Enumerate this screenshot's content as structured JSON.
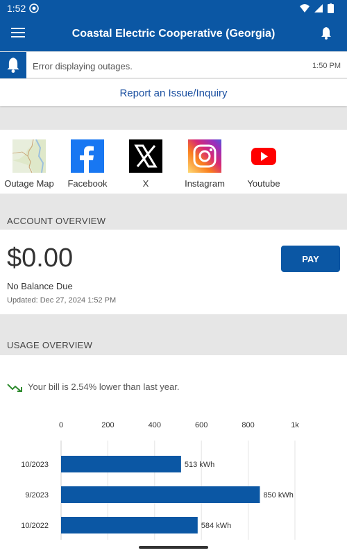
{
  "status_bar": {
    "time": "1:52"
  },
  "app_bar": {
    "title": "Coastal Electric Cooperative (Georgia)"
  },
  "alert": {
    "message": "Error displaying outages.",
    "time": "1:50 PM"
  },
  "report_link": "Report an Issue/Inquiry",
  "social": [
    {
      "label": "Outage Map",
      "icon": "map-icon"
    },
    {
      "label": "Facebook",
      "icon": "facebook-icon"
    },
    {
      "label": "X",
      "icon": "x-icon"
    },
    {
      "label": "Instagram",
      "icon": "instagram-icon"
    },
    {
      "label": "Youtube",
      "icon": "youtube-icon"
    }
  ],
  "account": {
    "section_title": "ACCOUNT OVERVIEW",
    "amount": "$0.00",
    "status": "No Balance Due",
    "updated": "Updated:  Dec 27, 2024 1:52 PM",
    "pay_label": "PAY"
  },
  "usage": {
    "section_title": "USAGE OVERVIEW",
    "trend_text": "Your bill is 2.54% lower than last year.",
    "trend_color": "#2e8b2e"
  },
  "colors": {
    "brand": "#0b57a4",
    "link": "#1a4fa0"
  },
  "chart_data": {
    "type": "bar",
    "orientation": "horizontal",
    "categories": [
      "10/2023",
      "9/2023",
      "10/2022"
    ],
    "values": [
      513,
      850,
      584
    ],
    "value_labels": [
      "513 kWh",
      "850 kWh",
      "584 kWh"
    ],
    "x_ticks": [
      "0",
      "200",
      "400",
      "600",
      "800",
      "1k"
    ],
    "xlim": [
      0,
      1000
    ],
    "grid": true,
    "color": "#0b57a4"
  }
}
